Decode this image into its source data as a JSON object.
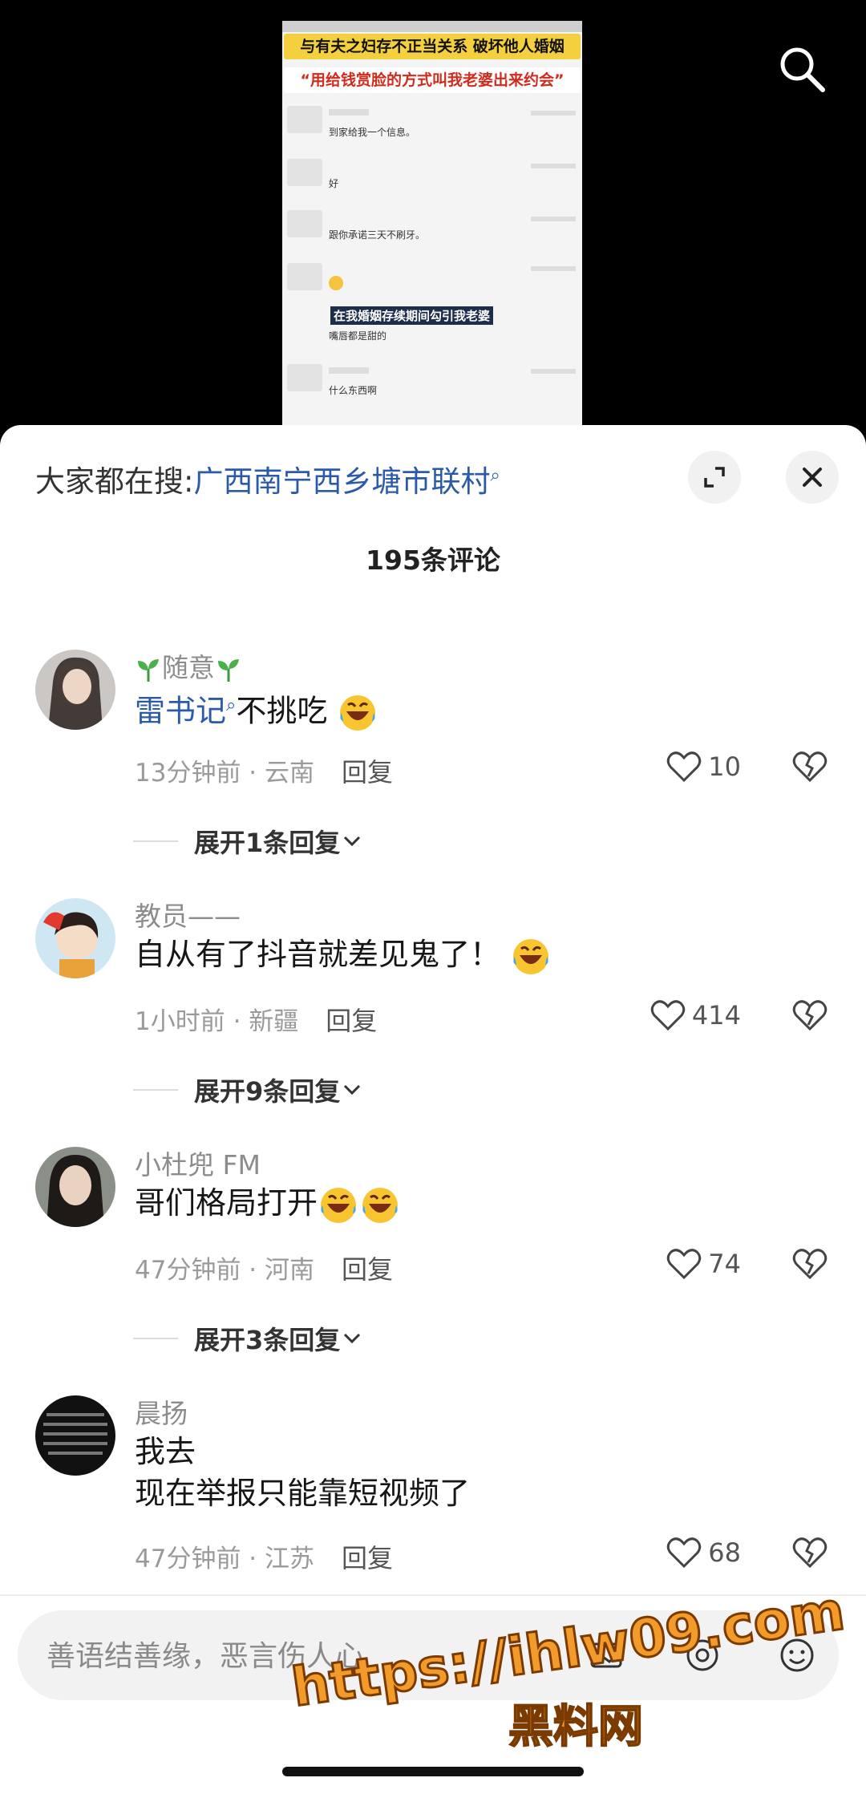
{
  "video": {
    "banner_line_1": "与有夫之妇存不正当关系  破坏他人婚姻",
    "banner_line_2": "“用给钱赏脸的方式叫我老婆出来约会”",
    "messages": [
      "到家给我一个信息。",
      "好",
      "跟你承诺三天不刷牙。",
      "嘴唇都是甜的",
      "什么东西啊"
    ],
    "caption": "在我婚姻存续期间勾引我老婆"
  },
  "panel": {
    "hot_search_prefix": "大家都在搜:",
    "hot_search_term": "广西南宁西乡塘市联村",
    "comment_count": "195条评论"
  },
  "comments": [
    {
      "username": "随意",
      "text_link": "雷书记",
      "text": "不挑吃",
      "time_location": "13分钟前 · 云南",
      "reply_label": "回复",
      "likes": "10",
      "expand_label": "展开1条回复"
    },
    {
      "username": "教员——",
      "text": "自从有了抖音就差见鬼了！",
      "time_location": "1小时前 · 新疆",
      "reply_label": "回复",
      "likes": "414",
      "expand_label": "展开9条回复"
    },
    {
      "username": "小杜兜 FM",
      "text": "哥们格局打开",
      "time_location": "47分钟前 · 河南",
      "reply_label": "回复",
      "likes": "74",
      "expand_label": "展开3条回复"
    },
    {
      "username": "晨扬",
      "text_line_1": "我去",
      "text_line_2": "现在举报只能靠短视频了",
      "time_location": "47分钟前 · 江苏",
      "reply_label": "回复",
      "likes": "68"
    }
  ],
  "input": {
    "placeholder": "善语结善缘，恶言伤人心"
  },
  "watermark": {
    "url": "https://ihlw09.com",
    "sub": "黑料网"
  },
  "icons": {
    "search": "search-icon",
    "expand": "expand-icon",
    "close": "close-icon",
    "heart": "heart-icon",
    "dislike": "broken-heart-icon",
    "chevron": "chevron-down-icon",
    "emoji": "laughing-emoji-icon",
    "sprout": "sprout-icon"
  }
}
